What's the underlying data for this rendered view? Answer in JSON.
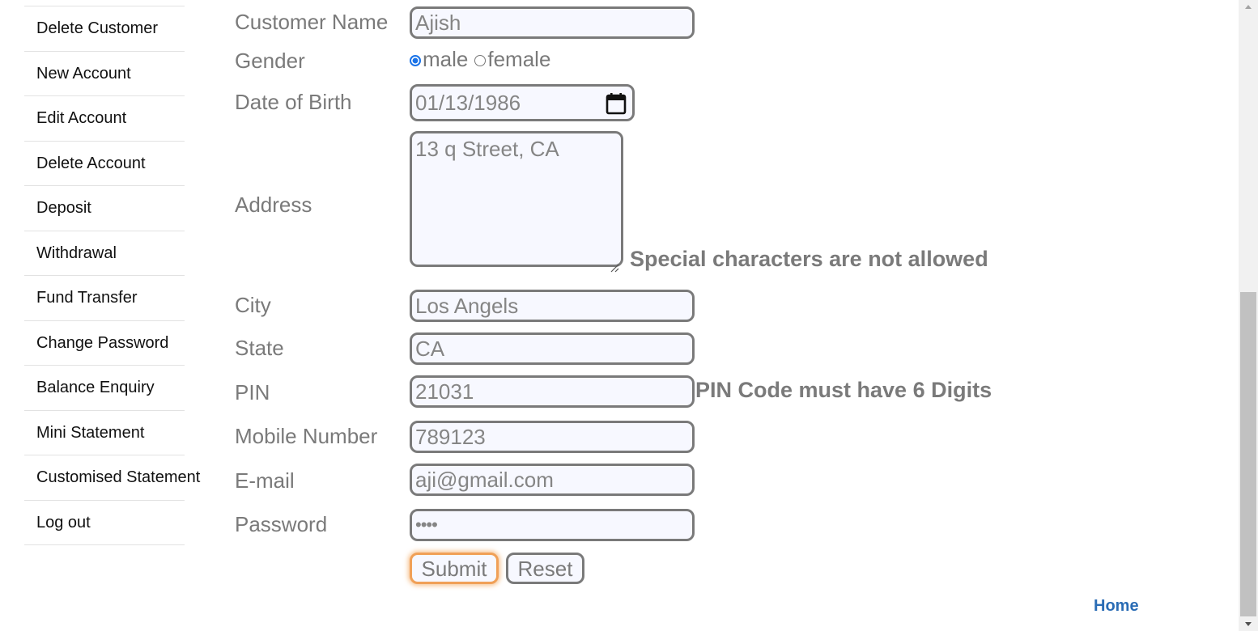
{
  "sidebar": {
    "items": [
      {
        "label": "Delete Customer"
      },
      {
        "label": "New Account"
      },
      {
        "label": "Edit Account"
      },
      {
        "label": "Delete Account"
      },
      {
        "label": "Deposit"
      },
      {
        "label": "Withdrawal"
      },
      {
        "label": "Fund Transfer"
      },
      {
        "label": "Change Password"
      },
      {
        "label": "Balance Enquiry"
      },
      {
        "label": "Mini Statement"
      },
      {
        "label": "Customised Statement"
      },
      {
        "label": "Log out"
      }
    ]
  },
  "form": {
    "customer_name": {
      "label": "Customer Name",
      "value": "Ajish"
    },
    "gender": {
      "label": "Gender",
      "options": [
        "male",
        "female"
      ],
      "selected": "male"
    },
    "dob": {
      "label": "Date of Birth",
      "value": "01/13/1986",
      "icon": "calendar-icon"
    },
    "address": {
      "label": "Address",
      "value": "13 q Street, CA",
      "error": "Special characters are not allowed"
    },
    "city": {
      "label": "City",
      "value": "Los Angels"
    },
    "state": {
      "label": "State",
      "value": "CA"
    },
    "pin": {
      "label": "PIN",
      "value": "21031",
      "error": "PIN Code must have 6 Digits"
    },
    "mobile": {
      "label": "Mobile Number",
      "value": "789123"
    },
    "email": {
      "label": "E-mail",
      "value": "aji@gmail.com"
    },
    "password": {
      "label": "Password",
      "value": "••••"
    },
    "submit_label": "Submit",
    "reset_label": "Reset"
  },
  "footer": {
    "home_label": "Home"
  },
  "colors": {
    "label": "#7a7a7a",
    "field_bg": "#f7f8ff",
    "focus_ring": "#f0a057",
    "link": "#2a6cb5",
    "radio_checked": "#1a73e8"
  }
}
